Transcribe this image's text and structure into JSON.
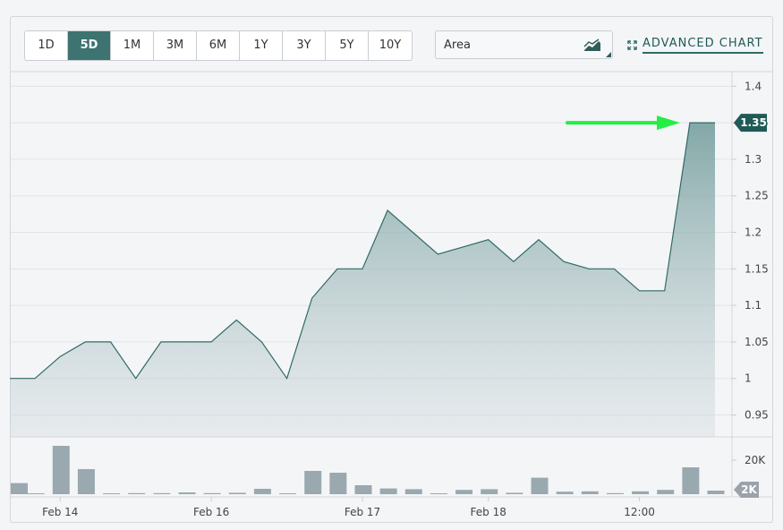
{
  "toolbar": {
    "periods": [
      "1D",
      "5D",
      "1M",
      "3M",
      "6M",
      "1Y",
      "3Y",
      "5Y",
      "10Y"
    ],
    "active_period": "5D",
    "chart_type": "Area",
    "advanced_label": "ADVANCED CHART"
  },
  "colors": {
    "accent": "#2f6a66",
    "price_line": "#2f6a66",
    "volume_bar": "#9aa9b0",
    "annotation_arrow": "#22ee44"
  },
  "chart_data": {
    "type": "area",
    "x_tick_labels": [
      "Feb 14",
      "Feb 16",
      "Feb 17",
      "Feb 18",
      "12:00"
    ],
    "price": {
      "values": [
        1.0,
        1.0,
        1.03,
        1.05,
        1.05,
        1.0,
        1.05,
        1.05,
        1.05,
        1.08,
        1.05,
        1.0,
        1.11,
        1.15,
        1.15,
        1.23,
        1.2,
        1.17,
        1.18,
        1.19,
        1.16,
        1.19,
        1.16,
        1.15,
        1.15,
        1.12,
        1.12,
        1.35,
        1.35
      ],
      "ylim": [
        0.92,
        1.42
      ],
      "y_ticks": [
        "1.4",
        "1.35",
        "1.3",
        "1.25",
        "1.2",
        "1.15",
        "1.1",
        "1.05",
        "1",
        "0.95"
      ],
      "last_value": "1.35"
    },
    "volume": {
      "values": [
        3100,
        200,
        13500,
        7000,
        200,
        300,
        300,
        500,
        300,
        400,
        1500,
        0,
        6500,
        6000,
        2500,
        1600,
        1400,
        200,
        1200,
        1400,
        400,
        4600,
        700,
        800,
        300,
        800,
        1200,
        7500,
        1000
      ],
      "ylim": [
        0,
        15500
      ],
      "y_ticks": [
        "20K"
      ],
      "last_value": "2K"
    }
  }
}
